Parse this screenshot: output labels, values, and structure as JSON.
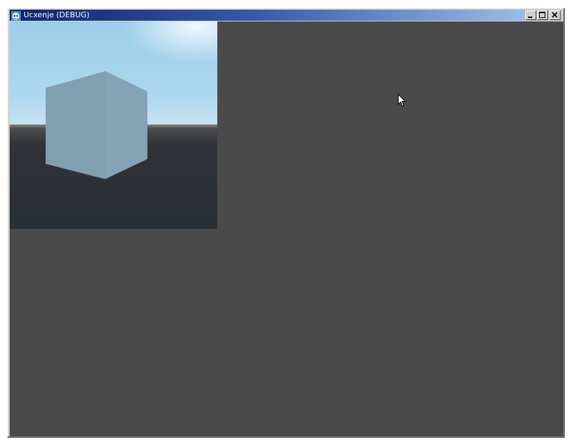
{
  "window": {
    "title": "Ucxenje (DEBUG)",
    "app_icon": "godot-engine-icon",
    "title_bar_colors": [
      "#0a246a",
      "#a6caf0"
    ],
    "buttons": [
      {
        "name": "minimize-button",
        "icon": "minimize-icon"
      },
      {
        "name": "maximize-button",
        "icon": "maximize-icon"
      },
      {
        "name": "close-button",
        "icon": "close-icon"
      }
    ]
  },
  "client": {
    "background_color": "#4a4a4a"
  },
  "viewport": {
    "scene": "3d-cube-on-ground",
    "sky_color": "#a8d4ec",
    "ground_color": "#2b3035",
    "cube_color": "#84a0b4"
  },
  "cursor": {
    "icon": "mouse-pointer-icon"
  }
}
